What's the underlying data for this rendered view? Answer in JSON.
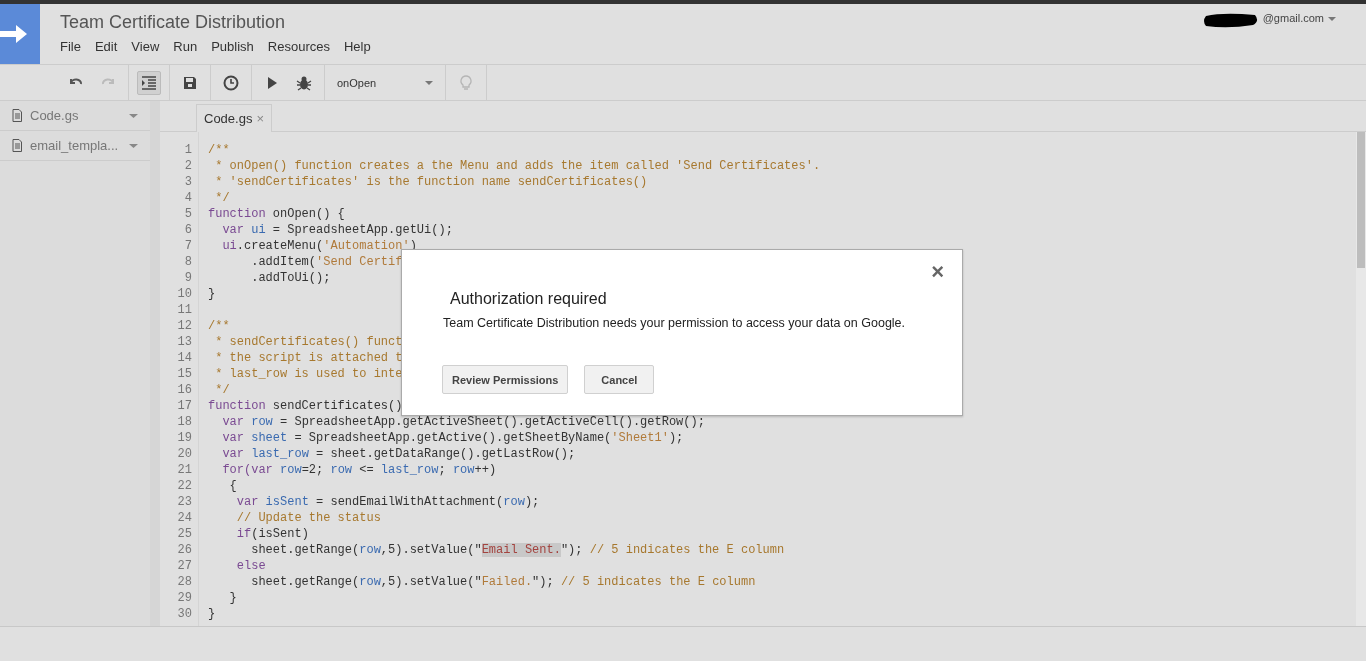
{
  "header": {
    "title": "Team Certificate Distribution",
    "account": "@gmail.com",
    "menu": [
      "File",
      "Edit",
      "View",
      "Run",
      "Publish",
      "Resources",
      "Help"
    ]
  },
  "toolbar": {
    "indent_toggle": {
      "on": true
    },
    "function_select": {
      "value": "onOpen"
    },
    "bulb": {
      "disabled": true
    }
  },
  "sidebar": {
    "items": [
      {
        "label": "Code.gs"
      },
      {
        "label": "email_templa..."
      }
    ]
  },
  "tabs": [
    {
      "label": "Code.gs",
      "close": "×",
      "selected": true
    }
  ],
  "editor": {
    "lines": [
      {
        "number": "1",
        "segments": [
          {
            "kind": "comment",
            "text": "/**"
          }
        ]
      },
      {
        "number": "2",
        "segments": [
          {
            "kind": "comment",
            "text": " * onOpen() function creates a the Menu and adds the item called 'Send Certificates'."
          }
        ]
      },
      {
        "number": "3",
        "segments": [
          {
            "kind": "comment",
            "text": " * 'sendCertificates' is the function name sendCertificates()"
          }
        ]
      },
      {
        "number": "4",
        "segments": [
          {
            "kind": "comment",
            "text": " */"
          }
        ]
      },
      {
        "number": "5",
        "segments": [
          {
            "kind": "keyword",
            "text": "function"
          },
          {
            "kind": "plain",
            "text": " onOpen() {"
          }
        ]
      },
      {
        "number": "6",
        "segments": [
          {
            "kind": "keyword",
            "text": "  var"
          },
          {
            "kind": "variable",
            "text": " ui"
          },
          {
            "kind": "plain",
            "text": " = SpreadsheetApp.getUi();"
          }
        ]
      },
      {
        "number": "7",
        "segments": [
          {
            "kind": "keyword",
            "text": "  ui"
          },
          {
            "kind": "plain",
            "text": ".createMenu("
          },
          {
            "kind": "string",
            "text": "'Automation'"
          },
          {
            "kind": "plain",
            "text": ")"
          }
        ]
      },
      {
        "number": "8",
        "segments": [
          {
            "kind": "plain",
            "text": "      .addItem("
          },
          {
            "kind": "string",
            "text": "'Send Certif"
          }
        ]
      },
      {
        "number": "9",
        "segments": [
          {
            "kind": "plain",
            "text": "      .addToUi();"
          }
        ]
      },
      {
        "number": "10",
        "segments": [
          {
            "kind": "plain",
            "text": "}"
          }
        ]
      },
      {
        "number": "11"
      },
      {
        "number": "12",
        "segments": [
          {
            "kind": "comment",
            "text": "/**"
          }
        ]
      },
      {
        "number": "13",
        "segments": [
          {
            "kind": "comment",
            "text": " * sendCertificates() funct"
          }
        ]
      },
      {
        "number": "14",
        "segments": [
          {
            "kind": "comment",
            "text": " * the script is attached t"
          }
        ]
      },
      {
        "number": "15",
        "segments": [
          {
            "kind": "comment",
            "text": " * last_row is used to inte"
          }
        ]
      },
      {
        "number": "16",
        "segments": [
          {
            "kind": "comment",
            "text": " */"
          }
        ]
      },
      {
        "number": "17",
        "segments": [
          {
            "kind": "keyword",
            "text": "function"
          },
          {
            "kind": "plain",
            "text": " sendCertificates()"
          }
        ]
      },
      {
        "number": "18",
        "segments": [
          {
            "kind": "keyword",
            "text": "  var"
          },
          {
            "kind": "variable",
            "text": " row"
          },
          {
            "kind": "plain",
            "text": " = SpreadsheetApp.getActiveSheet().getActiveCell().getRow();"
          }
        ]
      },
      {
        "number": "19",
        "segments": [
          {
            "kind": "keyword",
            "text": "  var"
          },
          {
            "kind": "variable",
            "text": " sheet"
          },
          {
            "kind": "plain",
            "text": " = SpreadsheetApp.getActive().getSheetByName("
          },
          {
            "kind": "string",
            "text": "'Sheet1'"
          },
          {
            "kind": "plain",
            "text": ");"
          }
        ]
      },
      {
        "number": "20",
        "segments": [
          {
            "kind": "keyword",
            "text": "  var"
          },
          {
            "kind": "variable",
            "text": " last_row"
          },
          {
            "kind": "plain",
            "text": " = sheet.getDataRange().getLastRow();"
          }
        ]
      },
      {
        "number": "21",
        "segments": [
          {
            "kind": "keyword",
            "text": "  for(var"
          },
          {
            "kind": "variable",
            "text": " row"
          },
          {
            "kind": "plain",
            "text": "=2; "
          },
          {
            "kind": "variable",
            "text": "row"
          },
          {
            "kind": "plain",
            "text": " <= "
          },
          {
            "kind": "variable",
            "text": "last_row"
          },
          {
            "kind": "plain",
            "text": "; "
          },
          {
            "kind": "variable",
            "text": "row"
          },
          {
            "kind": "plain",
            "text": "++)"
          }
        ]
      },
      {
        "number": "22",
        "segments": [
          {
            "kind": "plain",
            "text": "   {"
          }
        ]
      },
      {
        "number": "23",
        "segments": [
          {
            "kind": "keyword",
            "text": "    var"
          },
          {
            "kind": "variable",
            "text": " isSent"
          },
          {
            "kind": "plain",
            "text": " = sendEmailWithAttachment("
          },
          {
            "kind": "variable",
            "text": "row"
          },
          {
            "kind": "plain",
            "text": ");"
          }
        ]
      },
      {
        "number": "24",
        "segments": [
          {
            "kind": "comment",
            "text": "    // Update the status"
          }
        ]
      },
      {
        "number": "25",
        "segments": [
          {
            "kind": "keyword",
            "text": "    if"
          },
          {
            "kind": "plain",
            "text": "(isSent)"
          }
        ]
      },
      {
        "number": "26",
        "segments": [
          {
            "kind": "plain",
            "text": "      sheet.getRange("
          },
          {
            "kind": "variable",
            "text": "row"
          },
          {
            "kind": "plain",
            "text": ",5).setValue(\""
          },
          {
            "kind": "match",
            "text": "Email Sent."
          },
          {
            "kind": "plain",
            "text": "\"); "
          },
          {
            "kind": "comment",
            "text": "// 5 indicates the E column"
          }
        ]
      },
      {
        "number": "27",
        "segments": [
          {
            "kind": "keyword",
            "text": "    else"
          }
        ]
      },
      {
        "number": "28",
        "segments": [
          {
            "kind": "plain",
            "text": "      sheet.getRange("
          },
          {
            "kind": "variable",
            "text": "row"
          },
          {
            "kind": "plain",
            "text": ",5).setValue(\""
          },
          {
            "kind": "string",
            "text": "Failed."
          },
          {
            "kind": "plain",
            "text": "\"); "
          },
          {
            "kind": "comment",
            "text": "// 5 indicates the E column"
          }
        ]
      },
      {
        "number": "29",
        "segments": [
          {
            "kind": "plain",
            "text": "   }"
          }
        ]
      },
      {
        "number": "30",
        "segments": [
          {
            "kind": "plain",
            "text": "}"
          }
        ]
      }
    ]
  },
  "dialog": {
    "title": "Authorization required",
    "message": "Team Certificate Distribution needs your permission to access your data on Google.",
    "close": "×",
    "buttons": [
      "Review Permissions",
      "Cancel"
    ]
  }
}
